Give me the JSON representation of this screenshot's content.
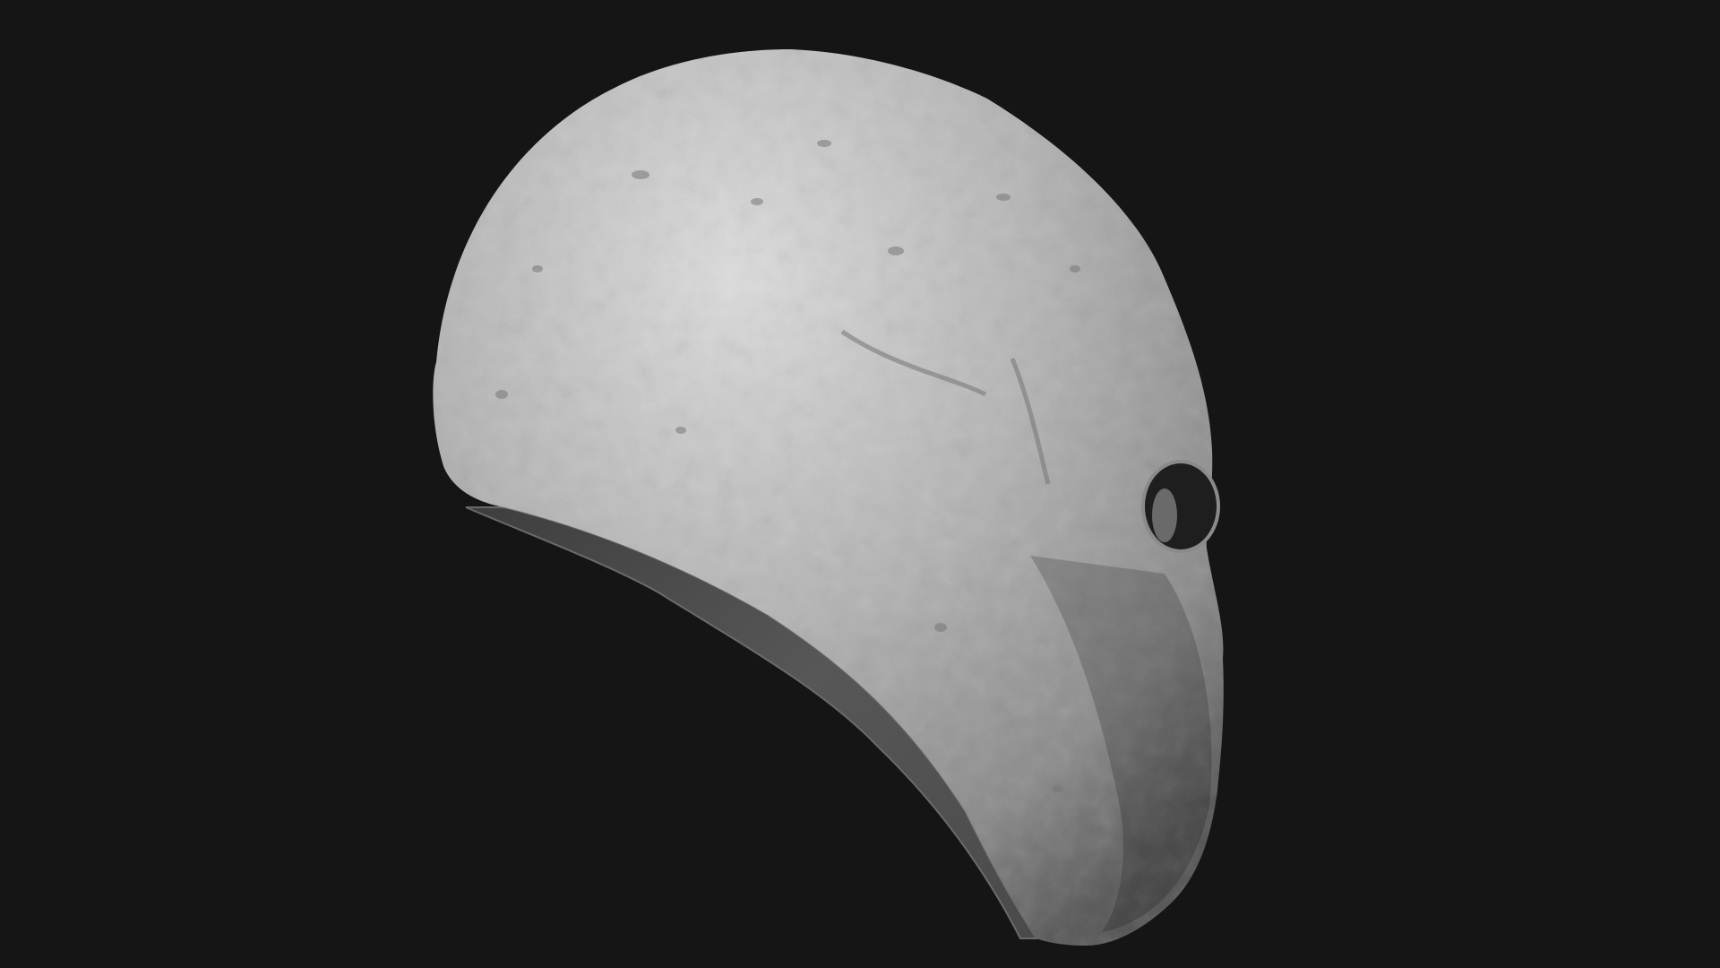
{
  "scene": {
    "subject": "sculpted mask",
    "colors": {
      "background": "#151515",
      "surface_light": "#d8d8d8",
      "surface_mid": "#a8a8a8",
      "surface_dark": "#5a5a5a",
      "inner_shell": "#4e4e4e",
      "eye_cavity": "#1e1e1e"
    }
  }
}
